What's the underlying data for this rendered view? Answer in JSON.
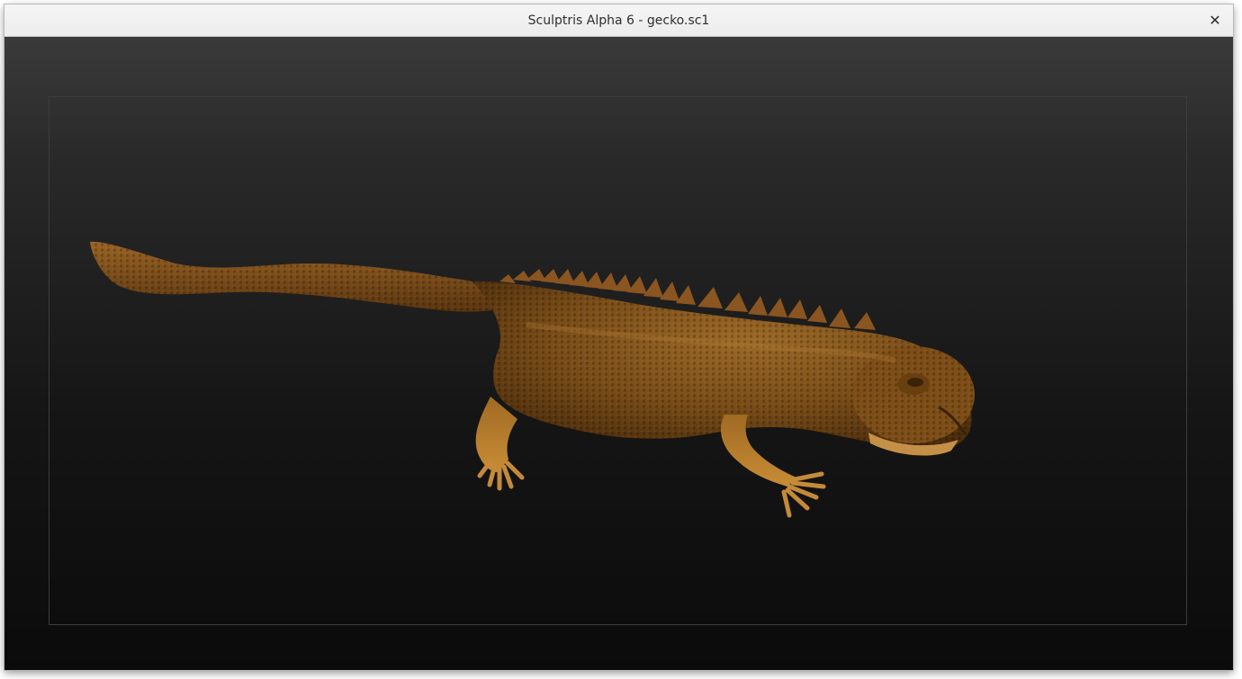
{
  "window": {
    "title": "Sculptris Alpha 6 - gecko.sc1",
    "close_label": "✕"
  },
  "viewport": {
    "model_name": "gecko",
    "model_color": "#8a5a1e",
    "model_highlight": "#c48a3a",
    "background_top": "#3a3a3a",
    "background_bottom": "#0b0b0b"
  }
}
